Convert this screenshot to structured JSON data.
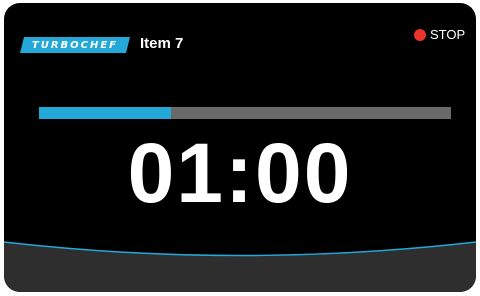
{
  "header": {
    "brand_logo_text": "TURBOCHEF",
    "item_title": "Item 7",
    "stop_label": "STOP"
  },
  "progress": {
    "fraction": 0.32
  },
  "timer": {
    "display": "01:00"
  },
  "colors": {
    "background": "#000000",
    "accent": "#23a8d8",
    "progress_track": "#6a6a6a",
    "stop": "#e8342b",
    "bottom_panel": "#2e2e2e"
  },
  "icons": {
    "stop": "stop-circle-icon",
    "logo": "turbochef-logo"
  }
}
